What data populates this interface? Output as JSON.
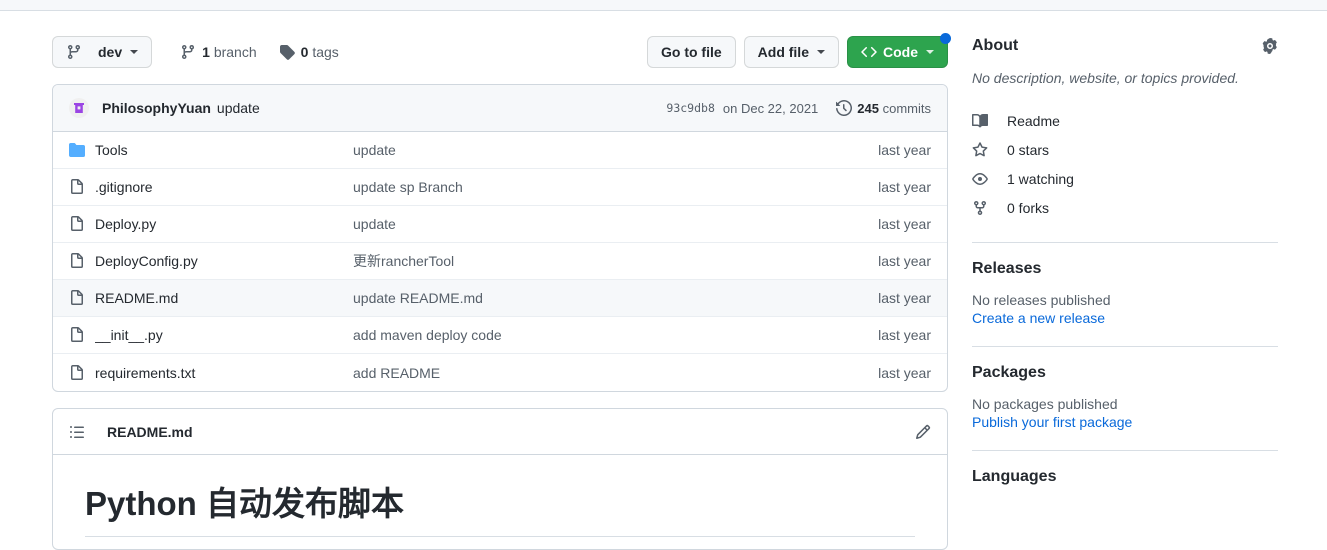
{
  "toolbar": {
    "branch_selector": "dev",
    "branches": "1 branch",
    "branches_count": "1",
    "branches_label": "branch",
    "tags": "0 tags",
    "tags_count": "0",
    "tags_label": "tags",
    "go_to_file": "Go to file",
    "add_file": "Add file",
    "code": "Code"
  },
  "commit_header": {
    "author": "PhilosophyYuan",
    "message": "update",
    "sha": "93c9db8",
    "date": "on Dec 22, 2021",
    "commits_count": "245",
    "commits_label": "commits"
  },
  "files": [
    {
      "icon": "folder-icon",
      "name": "Tools",
      "message": "update",
      "time": "last year",
      "hover": false
    },
    {
      "icon": "file-icon",
      "name": ".gitignore",
      "message": "update sp Branch",
      "time": "last year",
      "hover": false
    },
    {
      "icon": "file-icon",
      "name": "Deploy.py",
      "message": "update",
      "time": "last year",
      "hover": false
    },
    {
      "icon": "file-icon",
      "name": "DeployConfig.py",
      "message": "更新rancherTool",
      "time": "last year",
      "hover": false
    },
    {
      "icon": "file-icon",
      "name": "README.md",
      "message": "update README.md",
      "time": "last year",
      "hover": true
    },
    {
      "icon": "file-icon",
      "name": "__init__.py",
      "message": "add maven deploy code",
      "time": "last year",
      "hover": false
    },
    {
      "icon": "file-icon",
      "name": "requirements.txt",
      "message": "add README",
      "time": "last year",
      "hover": false
    }
  ],
  "readme": {
    "title": "README.md",
    "heading": "Python 自动发布脚本"
  },
  "sidebar": {
    "about_title": "About",
    "description": "No description, website, or topics provided.",
    "readme_link": "Readme",
    "stars": "0 stars",
    "watching": "1 watching",
    "forks": "0 forks",
    "releases_title": "Releases",
    "no_releases": "No releases published",
    "create_release": "Create a new release",
    "packages_title": "Packages",
    "no_packages": "No packages published",
    "publish_package": "Publish your first package",
    "languages_title": "Languages"
  },
  "colors": {
    "green_button": "#2da44e",
    "blue_dot": "#0969da",
    "link_blue": "#0969da",
    "folder_blue": "#54aeff",
    "avatar_purple": "#9b45e4",
    "border": "#d0d7de",
    "muted_text": "#57606a"
  }
}
